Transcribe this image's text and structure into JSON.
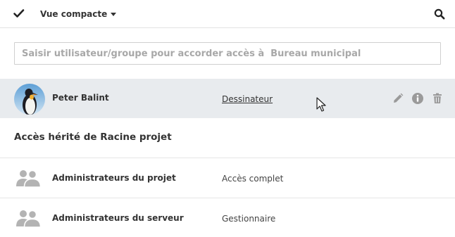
{
  "toolbar": {
    "select_icon": "checkmark-icon",
    "view_label": "Vue compacte",
    "search_icon": "search-icon"
  },
  "share": {
    "placeholder": "Saisir utilisateur/groupe pour accorder accès à  Bureau municipal"
  },
  "direct_access": {
    "name": "Peter Balint",
    "role": "Dessinateur",
    "actions": [
      "pencil-icon",
      "info-icon",
      "trash-icon"
    ]
  },
  "inherited": {
    "title": "Accès hérité de Racine projet",
    "rows": [
      {
        "name": "Administrateurs du projet",
        "role": "Accès complet"
      },
      {
        "name": "Administrateurs du serveur",
        "role": "Gestionnaire"
      }
    ]
  },
  "colors": {
    "selected_row": "#e8ebee",
    "icon_gray": "#9a9a9a",
    "group_icon": "#b3b3b3"
  }
}
